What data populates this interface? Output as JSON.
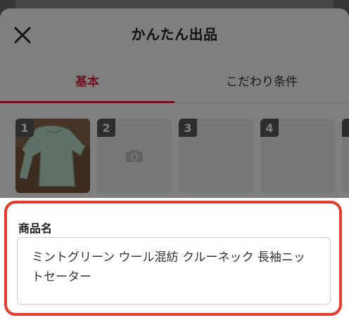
{
  "header": {
    "title": "かんたん出品",
    "close_icon": "close-icon"
  },
  "tabs": [
    {
      "label": "基本",
      "active": true
    },
    {
      "label": "こだわり条件",
      "active": false
    }
  ],
  "photos": {
    "slots": [
      {
        "number": "1",
        "filled": true,
        "image": "mint-green-sweater-photo"
      },
      {
        "number": "2",
        "filled": false,
        "icon": "camera-icon"
      },
      {
        "number": "3",
        "filled": false
      },
      {
        "number": "4",
        "filled": false
      },
      {
        "number": "",
        "filled": false
      }
    ]
  },
  "product_name": {
    "label": "商品名",
    "value": "ミントグリーン ウール混紡 クルーネック 長袖ニットセーター"
  },
  "colors": {
    "accent": "#e0253a",
    "highlight_border": "#e53b2c"
  }
}
